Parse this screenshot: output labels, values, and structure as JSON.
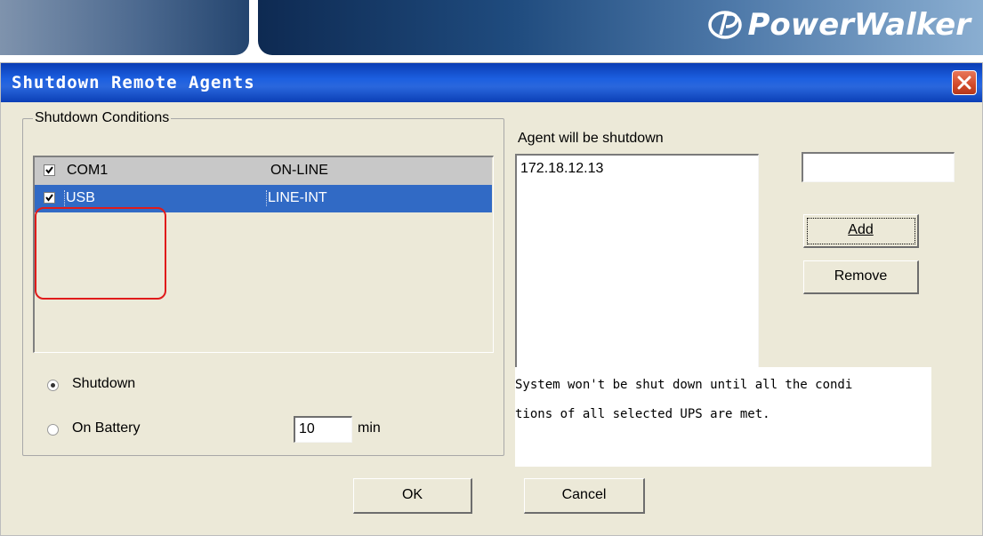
{
  "banner": {
    "brand": "PowerWalker"
  },
  "dialog": {
    "title": "Shutdown Remote Agents",
    "group_title": "Shutdown Conditions",
    "ups_list": [
      {
        "name": "COM1",
        "status": "ON-LINE",
        "checked": true,
        "selected": false
      },
      {
        "name": "USB",
        "status": "LINE-INT",
        "checked": true,
        "selected": true
      }
    ],
    "options": {
      "shutdown_label": "Shutdown",
      "on_battery_label": "On Battery",
      "selected": "Shutdown",
      "minutes_value": "10",
      "minutes_unit": "min"
    },
    "agents": {
      "label": "Agent will be shutdown",
      "items": [
        "172.18.12.13"
      ],
      "input_value": ""
    },
    "buttons": {
      "add": "Add",
      "remove": "Remove",
      "ok": "OK",
      "cancel": "Cancel"
    },
    "info_lines": [
      "System won't be shut down until all the condi",
      "tions of all selected UPS are met."
    ]
  },
  "colors": {
    "title_bar": "#0a3cb4",
    "dialog_bg": "#ece9d8",
    "selection": "#316ac5",
    "highlight_outline": "#e01b1b"
  }
}
